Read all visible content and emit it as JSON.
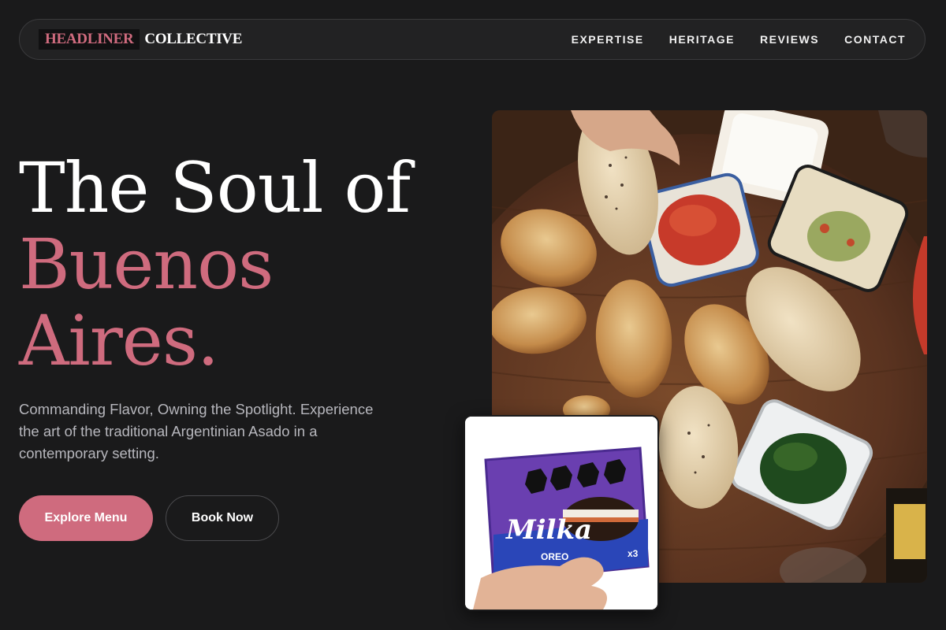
{
  "brand": {
    "highlight": "HEADLINER",
    "rest": "COLLECTIVE"
  },
  "nav": {
    "items": [
      {
        "label": "EXPERTISE"
      },
      {
        "label": "HERITAGE"
      },
      {
        "label": "REVIEWS"
      },
      {
        "label": "CONTACT"
      }
    ]
  },
  "hero": {
    "title_line1": "The Soul of",
    "title_line2": "Buenos",
    "title_line3": "Aires.",
    "subtitle": "Commanding Flavor, Owning the Spotlight. Experience the art of the traditional Argentinian Asado in a contemporary setting.",
    "primary_cta": "Explore Menu",
    "secondary_cta": "Book Now"
  },
  "images": {
    "main": {
      "alt": "Empanadas on wooden board with dipping sauces"
    },
    "inset": {
      "brand_text": "Milka",
      "sub_text": "OREO",
      "count_text": "x3"
    }
  },
  "colors": {
    "accent": "#cf6b7e",
    "background": "#1a1a1b"
  }
}
